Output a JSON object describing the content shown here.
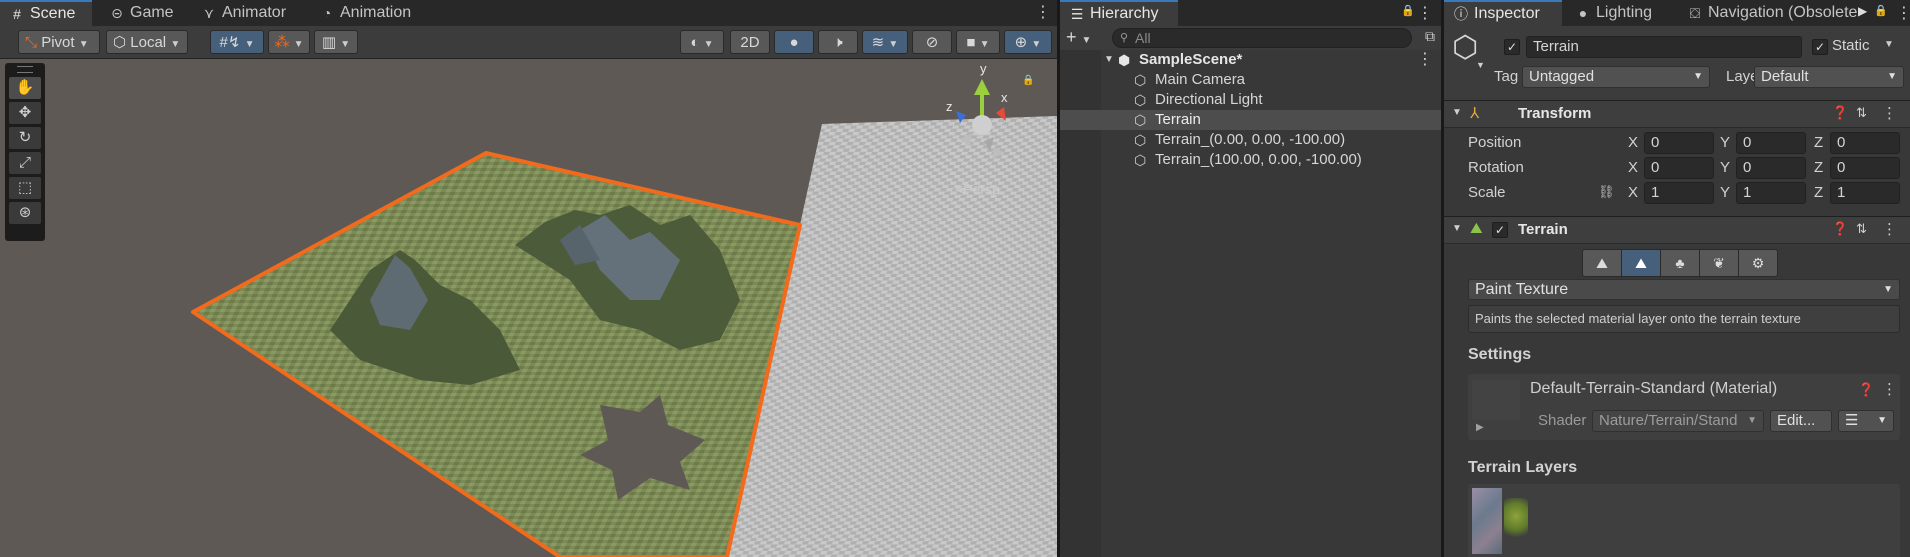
{
  "scene_panel": {
    "tabs": [
      {
        "label": "Scene",
        "icon": "grid-icon"
      },
      {
        "label": "Game",
        "icon": "gamepad-icon"
      },
      {
        "label": "Animator",
        "icon": "animator-icon"
      },
      {
        "label": "Animation",
        "icon": "clock-icon"
      }
    ],
    "toolbar": {
      "pivot_label": "Pivot",
      "local_label": "Local",
      "mode_2d_label": "2D"
    },
    "tools": [
      "hand-tool-icon",
      "move-tool-icon",
      "rotate-tool-icon",
      "scale-tool-icon",
      "rect-tool-icon",
      "transform-tool-icon"
    ],
    "gizmo": {
      "x": "x",
      "y": "y",
      "z": "z",
      "persp_label": "<Persp"
    }
  },
  "hierarchy": {
    "tab_label": "Hierarchy",
    "search_placeholder": "All",
    "scene_name": "SampleScene*",
    "items": [
      {
        "label": "Main Camera",
        "selected": false
      },
      {
        "label": "Directional Light",
        "selected": false
      },
      {
        "label": "Terrain",
        "selected": true
      },
      {
        "label": "Terrain_(0.00, 0.00, -100.00)",
        "selected": false
      },
      {
        "label": "Terrain_(100.00, 0.00, -100.00)",
        "selected": false
      }
    ]
  },
  "inspector": {
    "tabs": [
      {
        "label": "Inspector",
        "icon": "info-icon"
      },
      {
        "label": "Lighting",
        "icon": "bulb-icon"
      },
      {
        "label": "Navigation (Obsolete",
        "icon": "navigation-icon"
      }
    ],
    "object_name": "Terrain",
    "static_label": "Static",
    "tag_label": "Tag",
    "tag_value": "Untagged",
    "layer_label": "Layer",
    "layer_value": "Default",
    "transform": {
      "title": "Transform",
      "position_label": "Position",
      "rotation_label": "Rotation",
      "scale_label": "Scale",
      "position": {
        "x": "0",
        "y": "0",
        "z": "0"
      },
      "rotation": {
        "x": "0",
        "y": "0",
        "z": "0"
      },
      "scale": {
        "x": "1",
        "y": "1",
        "z": "1"
      },
      "axis_x": "X",
      "axis_y": "Y",
      "axis_z": "Z"
    },
    "terrain": {
      "title": "Terrain",
      "tool_icons": [
        "create-neighbor-icon",
        "paint-terrain-icon",
        "paint-trees-icon",
        "paint-details-icon",
        "terrain-settings-icon"
      ],
      "mode_value": "Paint Texture",
      "description": "Paints the selected material layer onto the terrain texture",
      "settings_label": "Settings",
      "material_name": "Default-Terrain-Standard (Material)",
      "shader_label": "Shader",
      "shader_value": "Nature/Terrain/Stand",
      "edit_label": "Edit...",
      "layers_label": "Terrain Layers"
    }
  },
  "colors": {
    "selection_outline": "#f26a1b",
    "accent_blue": "#3a79bb",
    "panel_bg": "#383838"
  }
}
